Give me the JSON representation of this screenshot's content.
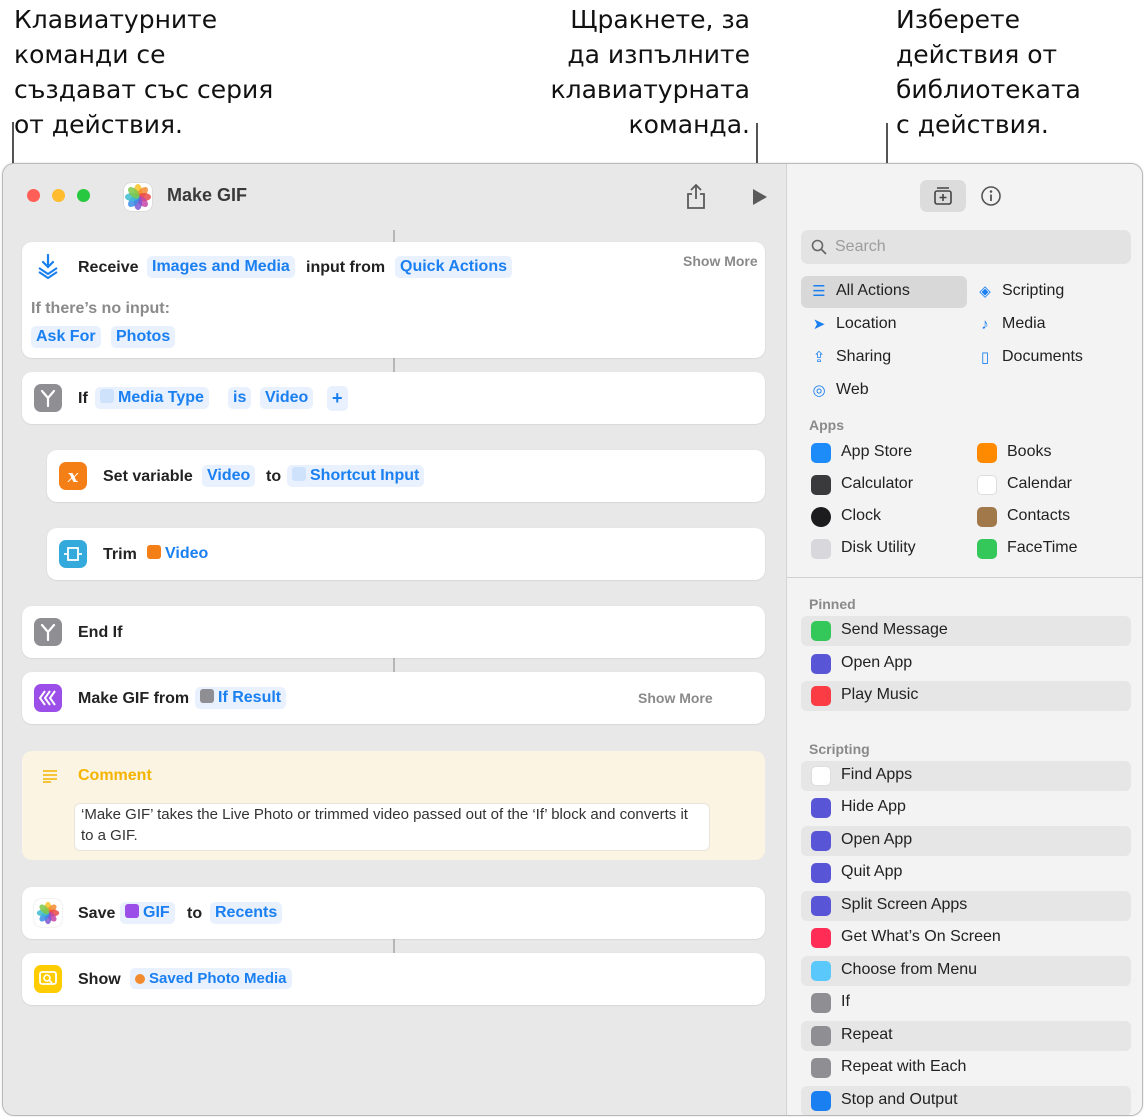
{
  "callouts": {
    "left": "Клавиатурните\nкоманди се\nсъздават със серия\nот действия.",
    "middle": "Щракнете, за\nда изпълните\nклавиатурната\nкоманда.",
    "right": "Изберете\nдействия от\nбиблиотеката\nс действия."
  },
  "window": {
    "title": "Make GIF"
  },
  "editor": {
    "receive": {
      "label": "Receive",
      "type": "Images and Media",
      "mid": "input from",
      "source": "Quick Actions",
      "show_more": "Show More",
      "no_input": "If there’s no input:",
      "ask": "Ask For",
      "photos": "Photos"
    },
    "if": {
      "label": "If",
      "var": "Media Type",
      "op": "is",
      "val": "Video",
      "plus": "+"
    },
    "setvar": {
      "label": "Set variable",
      "name": "Video",
      "to": "to",
      "input": "Shortcut Input"
    },
    "trim": {
      "label": "Trim",
      "var": "Video"
    },
    "endif": {
      "label": "End If"
    },
    "makegif": {
      "label": "Make GIF from",
      "var": "If Result",
      "show_more": "Show More"
    },
    "comment": {
      "title": "Comment",
      "text": "‘Make GIF’ takes the Live Photo or trimmed video passed out of the ‘If’ block and converts it to a GIF."
    },
    "save": {
      "label": "Save",
      "var": "GIF",
      "to": "to",
      "dest": "Recents"
    },
    "show": {
      "label": "Show",
      "var": "Saved Photo Media"
    }
  },
  "sidebar": {
    "search_placeholder": "Search",
    "categories": [
      {
        "label": "All Actions",
        "icon": "list-icon"
      },
      {
        "label": "Scripting",
        "icon": "scripting-icon"
      },
      {
        "label": "Location",
        "icon": "location-icon"
      },
      {
        "label": "Media",
        "icon": "music-note-icon"
      },
      {
        "label": "Sharing",
        "icon": "share-icon"
      },
      {
        "label": "Documents",
        "icon": "document-icon"
      },
      {
        "label": "Web",
        "icon": "compass-icon"
      }
    ],
    "apps_header": "Apps",
    "apps": [
      "App Store",
      "Books",
      "Calculator",
      "Calendar",
      "Clock",
      "Contacts",
      "Disk Utility",
      "FaceTime"
    ],
    "pinned_header": "Pinned",
    "pinned": [
      "Send Message",
      "Open App",
      "Play Music"
    ],
    "scripting_header": "Scripting",
    "scripting": [
      "Find Apps",
      "Hide App",
      "Open App",
      "Quit App",
      "Split Screen Apps",
      "Get What’s On Screen",
      "Choose from Menu",
      "If",
      "Repeat",
      "Repeat with Each",
      "Stop and Output"
    ]
  },
  "colors": {
    "accent": "#1a7ff0",
    "comment": "#f5b400"
  }
}
